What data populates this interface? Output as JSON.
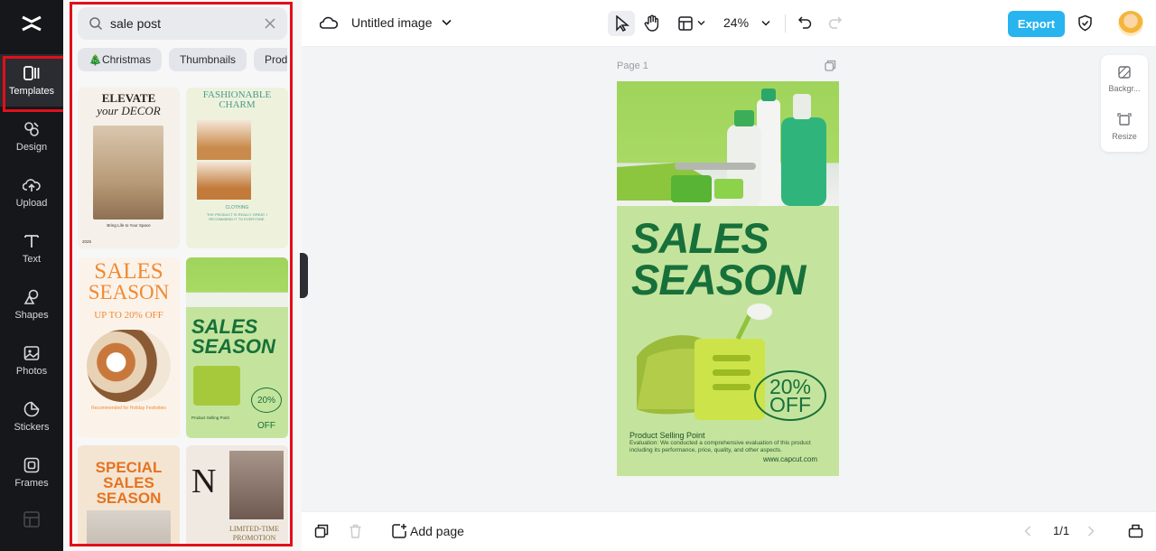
{
  "rail": {
    "items": [
      {
        "label": "Templates"
      },
      {
        "label": "Design"
      },
      {
        "label": "Upload"
      },
      {
        "label": "Text"
      },
      {
        "label": "Shapes"
      },
      {
        "label": "Photos"
      },
      {
        "label": "Stickers"
      },
      {
        "label": "Frames"
      }
    ]
  },
  "search": {
    "value": "sale post"
  },
  "chips": [
    {
      "label": "🎄Christmas"
    },
    {
      "label": "Thumbnails"
    },
    {
      "label": "Product"
    }
  ],
  "templates": [
    {
      "title_a": "ELEVATE",
      "title_b": "your DECOR",
      "caption": "Bring Life to Your Space",
      "year": "2025"
    },
    {
      "title_a": "FASHIONABLE",
      "title_b": "CHARM",
      "caption": "CLOTHING",
      "body": "THE PRODUCT IS REALLY GREAT. I RECOMMEND IT TO EVERYONE."
    },
    {
      "title_a": "SALES",
      "title_b": "SEASON",
      "caption": "UP TO 20% OFF",
      "body": "Recommended for Holiday Festivities"
    },
    {
      "title_a": "SALES",
      "title_b": "SEASON",
      "caption": "20% OFF",
      "body": "Product Selling Point"
    },
    {
      "title_a": "SPECIAL",
      "title_b": "SALES",
      "title_c": "SEASON"
    },
    {
      "title_a": "N",
      "caption": "LIMITED-TIME",
      "body": "PROMOTION"
    }
  ],
  "topbar": {
    "doc_title": "Untitled image",
    "zoom": "24%",
    "export_label": "Export"
  },
  "canvas": {
    "page_label": "Page 1",
    "title_line1": "SALES",
    "title_line2": "SEASON",
    "discount_line1": "20%",
    "discount_line2": "OFF",
    "selling_head": "Product Selling Point",
    "selling_body": "Evaluation: We conducted a comprehensive evaluation of this product including its performance, price, quality, and other aspects.",
    "url": "www.capcut.com",
    "colors": {
      "background": "#c4e49d",
      "title": "#17703a"
    }
  },
  "float_panel": {
    "background_label": "Backgr...",
    "resize_label": "Resize"
  },
  "bottombar": {
    "add_page_label": "Add page",
    "pager": "1/1"
  },
  "colors": {
    "accent": "#27b4ef",
    "highlight": "#e0101b",
    "rail": "#16171a"
  }
}
